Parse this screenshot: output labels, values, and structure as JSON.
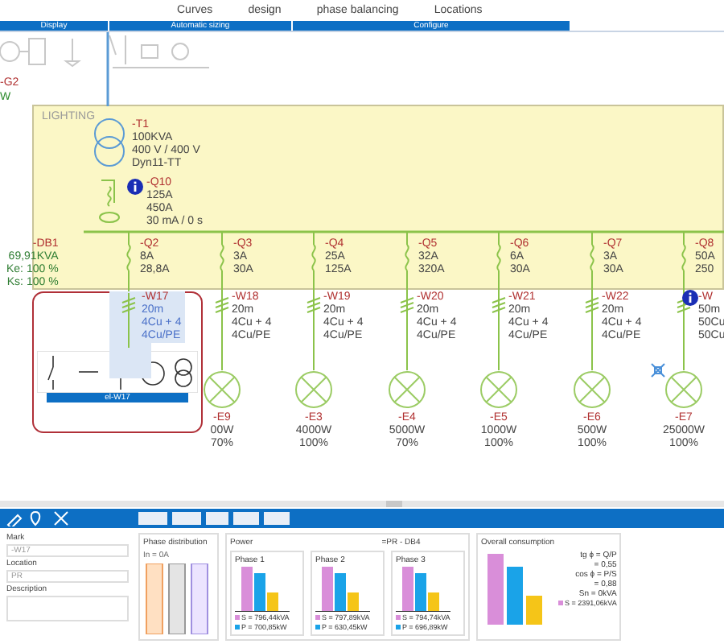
{
  "ribbon": {
    "buttons": [
      {
        "label": "Curves"
      },
      {
        "label": "design"
      },
      {
        "label": "phase balancing"
      },
      {
        "label": "Locations"
      }
    ],
    "groups": [
      {
        "label": "Display"
      },
      {
        "label": "Automatic sizing"
      },
      {
        "label": "Configure"
      }
    ]
  },
  "diagram": {
    "generator": {
      "mark": "-G2",
      "note": "W"
    },
    "board": {
      "title": "LIGHTING"
    },
    "transformer": {
      "mark": "-T1",
      "lines": [
        "100KVA",
        "400 V / 400 V",
        "Dyn11-TT"
      ]
    },
    "main_breaker": {
      "mark": "-Q10",
      "info": true,
      "lines": [
        "125A",
        "450A",
        "30 mA / 0 s"
      ]
    },
    "distribution": {
      "mark": "-DB1",
      "lines": [
        "69,91KVA",
        "Ke: 100 %",
        "Ks: 100 %"
      ]
    },
    "feeders": [
      {
        "breaker": "-Q2",
        "breaker_lines": [
          "8A",
          "28,8A"
        ],
        "cable": "-W17",
        "cable_lines": [
          "20m",
          "4Cu + 4",
          "4Cu/PE"
        ],
        "selected": true,
        "info": false
      },
      {
        "breaker": "-Q3",
        "breaker_lines": [
          "3A",
          "30A"
        ],
        "cable": "-W18",
        "cable_lines": [
          "20m",
          "4Cu + 4",
          "4Cu/PE"
        ],
        "selected": false,
        "info": false,
        "load": "-E9",
        "load_lines": [
          "00W",
          "70%"
        ]
      },
      {
        "breaker": "-Q4",
        "breaker_lines": [
          "25A",
          "125A"
        ],
        "cable": "-W19",
        "cable_lines": [
          "20m",
          "4Cu + 4",
          "4Cu/PE"
        ],
        "selected": false,
        "info": false,
        "load": "-E3",
        "load_lines": [
          "4000W",
          "100%"
        ]
      },
      {
        "breaker": "-Q5",
        "breaker_lines": [
          "32A",
          "320A"
        ],
        "cable": "-W20",
        "cable_lines": [
          "20m",
          "4Cu + 4",
          "4Cu/PE"
        ],
        "selected": false,
        "info": false,
        "load": "-E4",
        "load_lines": [
          "5000W",
          "70%"
        ]
      },
      {
        "breaker": "-Q6",
        "breaker_lines": [
          "6A",
          "30A"
        ],
        "cable": "-W21",
        "cable_lines": [
          "20m",
          "4Cu + 4",
          "4Cu/PE"
        ],
        "selected": false,
        "info": false,
        "load": "-E5",
        "load_lines": [
          "1000W",
          "100%"
        ]
      },
      {
        "breaker": "-Q7",
        "breaker_lines": [
          "3A",
          "30A"
        ],
        "cable": "-W22",
        "cable_lines": [
          "20m",
          "4Cu + 4",
          "4Cu/PE"
        ],
        "selected": false,
        "info": false,
        "load": "-E6",
        "load_lines": [
          "500W",
          "100%"
        ]
      },
      {
        "breaker": "-Q8",
        "breaker_lines": [
          "50A",
          "250"
        ],
        "cable": "-W",
        "cable_lines": [
          "50m",
          "50Cu",
          "50Cu"
        ],
        "selected": false,
        "info": true,
        "load": "-E7",
        "load_lines": [
          "25000W",
          "100%"
        ]
      }
    ]
  },
  "popup": {
    "label": "el-W17"
  },
  "properties": {
    "fields": [
      {
        "label": "Mark",
        "value": "-W17"
      },
      {
        "label": "Location",
        "value": "PR"
      },
      {
        "label": "Description"
      }
    ]
  },
  "phase_distribution": {
    "title": "Phase distribution",
    "legend": "In = 0A"
  },
  "power": {
    "title": "Power",
    "subtitle": "=PR - DB4",
    "phases": [
      {
        "title": "Phase 1",
        "legend": [
          "S = 796,44kVA",
          "P = 700,85kW"
        ]
      },
      {
        "title": "Phase 2",
        "legend": [
          "S = 797,89kVA",
          "P = 630,45kW"
        ]
      },
      {
        "title": "Phase 3",
        "legend": [
          "S = 794,74kVA",
          "P = 696,89kW"
        ]
      }
    ]
  },
  "overall": {
    "title": "Overall consumption",
    "lines": [
      "tg ϕ = Q/P",
      "= 0,55",
      "cos ϕ = P/S",
      "= 0,88",
      "Sn = 0kVA"
    ],
    "legend": "S = 2391,06kVA"
  }
}
